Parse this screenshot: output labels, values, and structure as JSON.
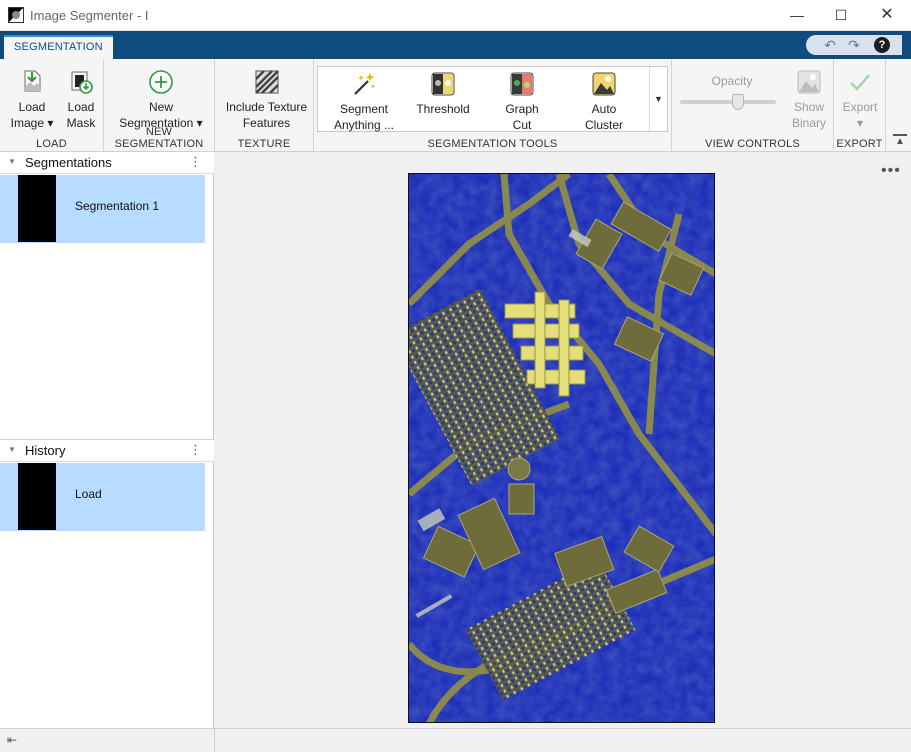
{
  "window": {
    "title": "Image Segmenter - I",
    "min_glyph": "—",
    "max_glyph": "☐",
    "close_glyph": "✕"
  },
  "ribbon": {
    "tab_label": "SEGMENTATION",
    "quick_access": {
      "undo_glyph": "↶",
      "redo_glyph": "↷",
      "help_glyph": "?"
    }
  },
  "toolstrip": {
    "load": {
      "label": "LOAD",
      "load_image": "Load\nImage ▾",
      "load_mask": "Load\nMask"
    },
    "new_segmentation": {
      "label": "NEW SEGMENTATION",
      "new_button": "New\nSegmentation ▾"
    },
    "texture": {
      "label": "TEXTURE",
      "include_texture": "Include Texture\nFeatures"
    },
    "segmentation_tools": {
      "label": "SEGMENTATION TOOLS",
      "segment_anything": "Segment\nAnything ...",
      "threshold": "Threshold",
      "graph_cut": "Graph\nCut",
      "auto_cluster": "Auto\nCluster",
      "more_glyph": "▼"
    },
    "view_controls": {
      "label": "VIEW CONTROLS",
      "opacity_label": "Opacity",
      "opacity_value": 0.6,
      "show_binary": "Show\nBinary"
    },
    "export": {
      "label": "EXPORT",
      "export_button": "Export\n▾"
    }
  },
  "left_panel": {
    "segmentations": {
      "title": "Segmentations",
      "items": [
        {
          "label": "Segmentation 1"
        }
      ]
    },
    "history": {
      "title": "History",
      "items": [
        {
          "label": "Load"
        }
      ]
    },
    "kebab_glyph": "⋮",
    "caret_glyph": "▼"
  },
  "main": {
    "more_glyph": "•••"
  },
  "statusbar": {
    "collapse_glyph": "⇤"
  },
  "colors": {
    "ribbon_blue": "#0e4c80",
    "selection": "#b7dcff",
    "image_blue": "#2433d6",
    "image_olive": "#9b9a4e",
    "image_yellow": "#e6e07a"
  }
}
